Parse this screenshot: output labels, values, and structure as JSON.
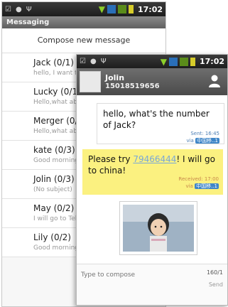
{
  "status": {
    "time": "17:02"
  },
  "back_screen": {
    "title": "Messaging",
    "compose_label": "Compose new message",
    "threads": [
      {
        "name": "Jack (0/1)",
        "snippet": "hello, I want to..."
      },
      {
        "name": "Lucky (0/1",
        "snippet": "Hello,what ab..."
      },
      {
        "name": "Merger (0/",
        "snippet": "Hello,what ab..."
      },
      {
        "name": "kate (0/3)",
        "snippet": "Good morning"
      },
      {
        "name": "Jolin (0/3)",
        "snippet": "(No subject)"
      },
      {
        "name": "May (0/2)",
        "snippet": "I will go to Tel"
      },
      {
        "name": "Lily (0/2)",
        "snippet": "Good morning"
      }
    ]
  },
  "front_screen": {
    "contact_name": "Jolin",
    "contact_phone": "15018519656",
    "sent_message": {
      "text": "hello, what's the number of Jack?",
      "meta": "Sent: 16:45",
      "via_label": "via",
      "carrier": "中国移..1"
    },
    "received_message": {
      "text_before": "Please try ",
      "phone_link": "79466444",
      "text_after": "! I will go to china!",
      "meta": "Received: 17:00",
      "via_label": "via",
      "carrier": "中国移..1"
    },
    "compose": {
      "placeholder": "Type to compose",
      "counter": "160/1",
      "send_label": "Send"
    }
  },
  "colors": {
    "received_bubble": "#fbf180",
    "header_dark": "#4a4a4a",
    "link_blue": "#7aa8d6",
    "carrier_badge": "#3f86c8"
  }
}
